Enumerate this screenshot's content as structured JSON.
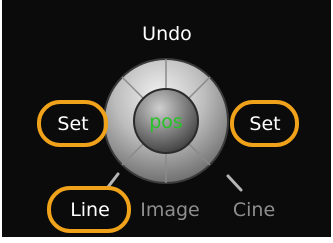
{
  "colors": {
    "background": "#0b0b0b",
    "label_text": "#ffffff",
    "disabled_text": "#8e8e8e",
    "highlight_ring": "#f0a21a",
    "center_text": "#27c227",
    "dial_light": "#f0f0f0",
    "dial_mid": "#a9a9a9",
    "dial_dark": "#545454"
  },
  "dial": {
    "center_label": "pos",
    "top_label": "Undo",
    "left_label": "Set",
    "right_label": "Set",
    "bottom_left_label": "Line",
    "bottom_center_label": "Image",
    "bottom_right_label": "Cine"
  },
  "highlighted": [
    "dial-left-set",
    "dial-right-set",
    "dial-line"
  ]
}
